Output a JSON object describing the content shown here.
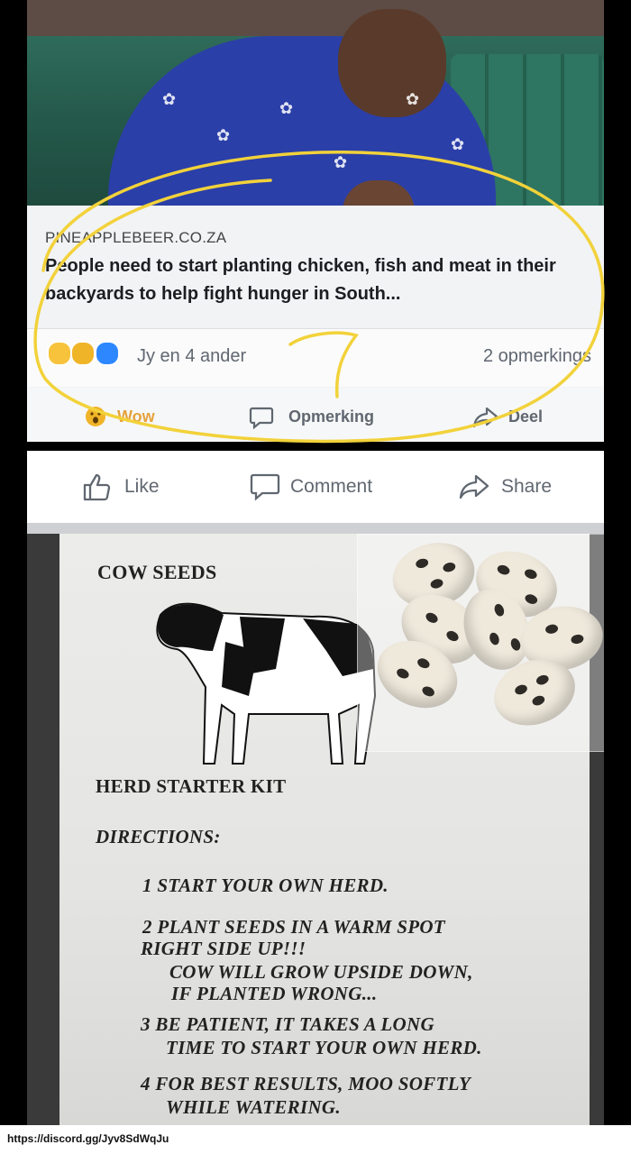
{
  "link_card": {
    "domain": "PINEAPPLEBEER.CO.ZA",
    "headline": "People need to start planting chicken, fish and meat in their backyards to help fight hunger in South...",
    "reactions_text": "Jy en 4 ander",
    "comments_count": "2 opmerkings",
    "action_wow": "Wow",
    "action_comment": "Opmerking",
    "action_share": "Deel"
  },
  "action_bar": {
    "like_label": "Like",
    "comment_label": "Comment",
    "share_label": "Share"
  },
  "note": {
    "title": "COW SEEDS",
    "subtitle": "HERD STARTER KIT",
    "directions_label": "DIRECTIONS:",
    "step1": "1 START YOUR OWN HERD.",
    "step2_line1": "2 PLANT SEEDS IN A WARM SPOT",
    "step2_line2": "RIGHT SIDE UP!!!",
    "step2_line3": "COW WILL GROW UPSIDE DOWN,",
    "step2_line4": "IF PLANTED WRONG...",
    "step3_line1": "3 BE PATIENT, IT TAKES A LONG",
    "step3_line2": "TIME TO START YOUR OWN HERD.",
    "step4_line1": "4 FOR BEST RESULTS, MOO SOFTLY",
    "step4_line2": "WHILE WATERING."
  },
  "footer": {
    "url": "https://discord.gg/Jyv8SdWqJu"
  },
  "colors": {
    "annotation": "#f2d23a",
    "facebook_gray": "#606770",
    "wow": "#e6a23c"
  }
}
